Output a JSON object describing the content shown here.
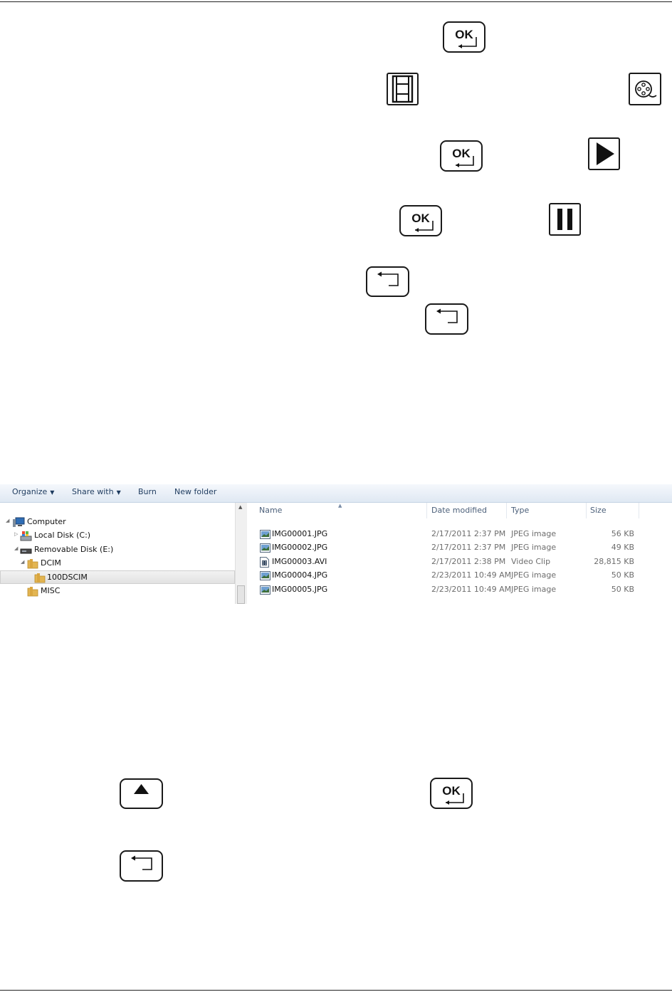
{
  "colors": {
    "ink": "#1a1a1a",
    "toolbar_text": "#1e3b5f",
    "header_text": "#4c607a"
  },
  "keys": {
    "ok_label": "OK",
    "icon_names": [
      "ok-return-key",
      "film-strip-icon",
      "film-reel-icon",
      "play-icon",
      "pause-icon",
      "back-key",
      "up-arrow-key"
    ]
  },
  "explorer": {
    "toolbar": {
      "organize": "Organize",
      "share_with": "Share with",
      "burn": "Burn",
      "new_folder": "New folder"
    },
    "tree": [
      {
        "label": "Computer",
        "icon": "computer-icon"
      },
      {
        "label": "Local Disk (C:)",
        "icon": "local-disk-icon"
      },
      {
        "label": "Removable Disk (E:)",
        "icon": "removable-disk-icon"
      },
      {
        "label": "DCIM",
        "icon": "folder-icon"
      },
      {
        "label": "100DSCIM",
        "icon": "folder-icon",
        "selected": true
      },
      {
        "label": "MISC",
        "icon": "folder-icon"
      }
    ],
    "columns": {
      "name": "Name",
      "date": "Date modified",
      "type": "Type",
      "size": "Size"
    },
    "files": [
      {
        "name": "IMG00001.JPG",
        "date": "2/17/2011 2:37 PM",
        "type": "JPEG image",
        "size": "56 KB",
        "icon": "image-file-icon"
      },
      {
        "name": "IMG00002.JPG",
        "date": "2/17/2011 2:37 PM",
        "type": "JPEG image",
        "size": "49 KB",
        "icon": "image-file-icon"
      },
      {
        "name": "IMG00003.AVI",
        "date": "2/17/2011 2:38 PM",
        "type": "Video Clip",
        "size": "28,815 KB",
        "icon": "video-file-icon"
      },
      {
        "name": "IMG00004.JPG",
        "date": "2/23/2011 10:49 AM",
        "type": "JPEG image",
        "size": "50 KB",
        "icon": "image-file-icon"
      },
      {
        "name": "IMG00005.JPG",
        "date": "2/23/2011 10:49 AM",
        "type": "JPEG image",
        "size": "50 KB",
        "icon": "image-file-icon"
      }
    ]
  }
}
